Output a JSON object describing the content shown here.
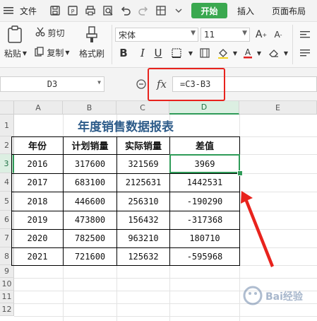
{
  "menu": {
    "file_label": "文件",
    "start_label": "开始",
    "insert_label": "插入",
    "page_layout_label": "页面布局"
  },
  "ribbon": {
    "paste_label": "粘贴",
    "cut_label": "剪切",
    "copy_label": "复制",
    "format_painter_label": "格式刷",
    "font_name": "宋体",
    "font_size": "11"
  },
  "formula_bar": {
    "cell_ref": "D3",
    "fx_label": "fx",
    "formula": "=C3-B3"
  },
  "columns": [
    "A",
    "B",
    "C",
    "D",
    "E"
  ],
  "rows": [
    "1",
    "2",
    "3",
    "4",
    "5",
    "6",
    "7",
    "8",
    "9",
    "10",
    "11",
    "12"
  ],
  "table": {
    "title": "年度销售数据报表",
    "headers": [
      "年份",
      "计划销量",
      "实际销量",
      "差值"
    ],
    "data": [
      [
        "2016",
        "317600",
        "321569",
        "3969"
      ],
      [
        "2017",
        "683100",
        "2125631",
        "1442531"
      ],
      [
        "2018",
        "446600",
        "256310",
        "-190290"
      ],
      [
        "2019",
        "473800",
        "156432",
        "-317368"
      ],
      [
        "2020",
        "782500",
        "963210",
        "180710"
      ],
      [
        "2021",
        "721600",
        "125632",
        "-595968"
      ]
    ]
  },
  "watermark": "Bai经验",
  "colors": {
    "accent_green": "#3aa84f",
    "highlight_red": "#e8231d",
    "title_blue": "#2e5c8a"
  },
  "icons": [
    "menu-icon",
    "save-icon",
    "export-icon",
    "print-icon",
    "preview-icon",
    "undo-icon",
    "redo-icon",
    "table-icon",
    "dropdown-icon",
    "paste-icon",
    "scissors-icon",
    "copy-icon",
    "brush-icon",
    "bold-icon",
    "italic-icon",
    "underline-icon",
    "border-icon",
    "merge-icon",
    "fill-color-icon",
    "font-color-icon",
    "eraser-icon",
    "grow-font-icon",
    "shrink-font-icon",
    "align-icon",
    "zoom-icon",
    "arrow-icon"
  ]
}
